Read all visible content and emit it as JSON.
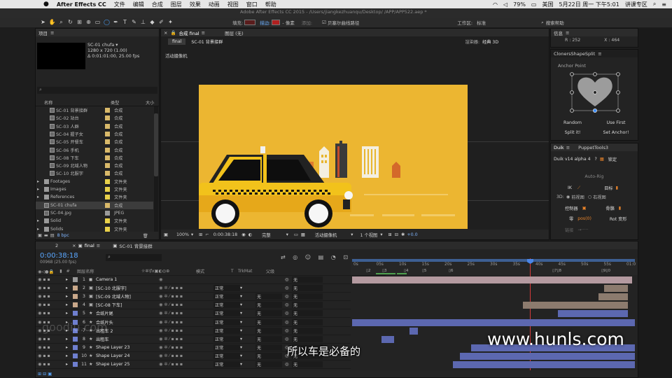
{
  "menubar": {
    "app": "After Effects CC",
    "items": [
      "文件",
      "编辑",
      "合成",
      "图层",
      "效果",
      "动画",
      "视图",
      "窗口",
      "帮助"
    ],
    "battery": "79%",
    "input": "美国",
    "clock": "5月22日 周一 下午5:01",
    "user": "讲课专区"
  },
  "titlebar": {
    "title": "Adobe After Effects CC 2015 - /Users/jiangkezhuanqu/Desktop/ /APP/APP522.aep *",
    "fill_label": "填充:",
    "stroke_label": "描边:",
    "px": "- 像素",
    "add": "添加:",
    "bezier": "贝塞尔曲线路径",
    "workspace_label": "工作区:",
    "workspace": "标准",
    "search": "搜索帮助"
  },
  "project": {
    "tab": "项目",
    "comp_name": "SC-01 chufa ▾",
    "comp_size": "1280 x 720 (1.00)",
    "comp_dur": "Δ 0:01:01:00, 25.00 fps",
    "col_name": "名称",
    "col_type": "类型",
    "col_size": "大小",
    "bpc": "8 bpc",
    "items": [
      {
        "name": "SC-01 背景接群",
        "type": "合成",
        "color": "#d9b96a",
        "indent": 1
      },
      {
        "name": "SC-02 站台",
        "type": "合成",
        "color": "#d9b96a",
        "indent": 1
      },
      {
        "name": "SC-03 人群",
        "type": "合成",
        "color": "#d9b96a",
        "indent": 1
      },
      {
        "name": "SC-04 握子女",
        "type": "合成",
        "color": "#d9b96a",
        "indent": 1
      },
      {
        "name": "SC-05 开餐车",
        "type": "合成",
        "color": "#d9b96a",
        "indent": 1
      },
      {
        "name": "SC-06 手机",
        "type": "合成",
        "color": "#d9b96a",
        "indent": 1
      },
      {
        "name": "SC-08 下车",
        "type": "合成",
        "color": "#d9b96a",
        "indent": 1
      },
      {
        "name": "SC-09 北域人物",
        "type": "合成",
        "color": "#d9b96a",
        "indent": 1
      },
      {
        "name": "SC-10 北服字",
        "type": "合成",
        "color": "#d9b96a",
        "indent": 1
      },
      {
        "name": "Footages",
        "type": "文件夹",
        "color": "#e8d04a",
        "indent": 0
      },
      {
        "name": "Images",
        "type": "文件夹",
        "color": "#e8d04a",
        "indent": 0
      },
      {
        "name": "References",
        "type": "文件夹",
        "color": "#e8d04a",
        "indent": 0
      },
      {
        "name": "SC-01 chufa",
        "type": "合成",
        "color": "#d9b96a",
        "indent": 0,
        "selected": true
      },
      {
        "name": "SC-04.jpg",
        "type": "JPEG",
        "color": "#9a9a9a",
        "indent": 0
      },
      {
        "name": "Solid",
        "type": "文件夹",
        "color": "#e8d04a",
        "indent": 0
      },
      {
        "name": "Solids",
        "type": "文件夹",
        "color": "#e8d04a",
        "indent": 0
      }
    ]
  },
  "viewer": {
    "tab_comp": "合成 final",
    "tab_layer": "图层 (无)",
    "sub_tab": "final",
    "breadcrumb": "SC-01 背景接群",
    "renderer_label": "渲染器:",
    "renderer": "经典 3D",
    "camera_note": "活动摄像机",
    "zoom": "100%",
    "timecode": "0:00:38:18",
    "quality": "完整",
    "camera": "活动摄像机",
    "views": "1 个视图",
    "offset": "+0.0",
    "colors": {
      "bg": "#e8b62f",
      "taxi": "#f2c21b",
      "city": "#3c3c3c"
    }
  },
  "info": {
    "tab": "信息",
    "r": "R : 252",
    "x": "X : 464"
  },
  "cloner": {
    "tab": "ClonersShapeSplit",
    "anchor": "Anchor Point",
    "random": "Random",
    "use_first": "Use First",
    "split": "Split it!",
    "set_anchor": "Set Anchor!"
  },
  "duik": {
    "tab1": "Duik",
    "tab2": "PuppetTools3",
    "version": "Duik v14 alpha 4",
    "lock": "锁定",
    "autorig": "Auto-Rig",
    "ik": "IK",
    "target": "目标",
    "view3d": "3D:",
    "front": "前视图",
    "right": "右视图",
    "controller": "控制器",
    "bone": "骨骼",
    "zero": "零",
    "pos0": "pos(0)",
    "rot": "Rot 变形",
    "link": "链接"
  },
  "timeline": {
    "tab_2": "2",
    "tab_final": "final",
    "tab_sc01": "SC-01 背景接群",
    "timecode": "0:00:38:18",
    "frames": "00968 (25.00 fps)",
    "col_name": "图层名称",
    "col_mode": "模式",
    "col_t": "T",
    "col_trk": "TrkMat",
    "col_parent": "父级",
    "ruler": [
      "0s",
      "05s",
      "10s",
      "15s",
      "20s",
      "25s",
      "30s",
      "35s",
      "40s",
      "45s",
      "50s",
      "55s",
      "01:0"
    ],
    "layers": [
      {
        "num": "1",
        "name": "Camera 1",
        "color": "#9a9a9a",
        "mode": "",
        "trk": "",
        "parent": "无"
      },
      {
        "num": "2",
        "name": "[SC-10 北服字]",
        "color": "#c9a88a",
        "mode": "正常",
        "trk": "",
        "parent": "无"
      },
      {
        "num": "3",
        "name": "[SC-09 北域人物]",
        "color": "#c9a88a",
        "mode": "正常",
        "trk": "无",
        "parent": "无"
      },
      {
        "num": "4",
        "name": "[SC-08 下车]",
        "color": "#c9a88a",
        "mode": "正常",
        "trk": "无",
        "parent": "无"
      },
      {
        "num": "5",
        "name": "合纸片尾",
        "color": "#6f7fcf",
        "mode": "正常",
        "trk": "无",
        "parent": "无"
      },
      {
        "num": "6",
        "name": "合纸片头",
        "color": "#6f7fcf",
        "mode": "正常",
        "trk": "无",
        "parent": "无"
      },
      {
        "num": "7",
        "name": "出租车 2",
        "color": "#6f7fcf",
        "mode": "正常",
        "trk": "无",
        "parent": "无"
      },
      {
        "num": "8",
        "name": "出租车",
        "color": "#6f7fcf",
        "mode": "正常",
        "trk": "无",
        "parent": "无"
      },
      {
        "num": "9",
        "name": "Shape Layer 23",
        "color": "#6f7fcf",
        "mode": "正常",
        "trk": "无",
        "parent": "无"
      },
      {
        "num": "10",
        "name": "Shape Layer 24",
        "color": "#6f7fcf",
        "mode": "正常",
        "trk": "无",
        "parent": "无"
      },
      {
        "num": "11",
        "name": "Shape Layer 25",
        "color": "#6f7fcf",
        "mode": "正常",
        "trk": "无",
        "parent": "无"
      }
    ]
  },
  "subtitle": "所以车是必备的",
  "watermark": "www.hunls.com",
  "watermark_left": "goodiu.com"
}
